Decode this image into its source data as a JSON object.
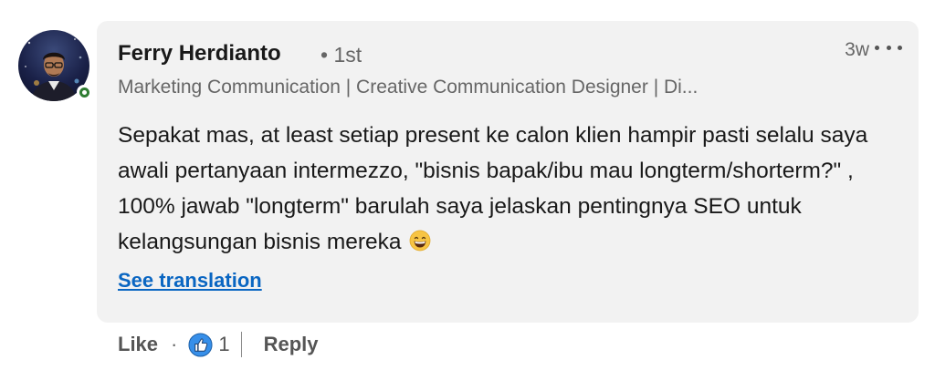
{
  "author": {
    "name": "Ferry Herdianto",
    "degree": "• 1st",
    "headline": "Marketing Communication | Creative Communication Designer | Di...",
    "status": "online",
    "status_color": "#2f7d32"
  },
  "timestamp": "3w",
  "menu_icon": "more-options-icon",
  "comment": {
    "text": "Sepakat mas, at least setiap present ke calon klien hampir pasti selalu saya awali pertanyaan intermezzo, \"bisnis bapak/ibu mau longterm/shorterm?\" , 100% jawab \"longterm\" barulah saya jelaskan pentingnya SEO untuk kelangsungan bisnis mereka",
    "emoji": "grinning-face-emoji",
    "see_translation": "See translation"
  },
  "actions": {
    "like_label": "Like",
    "separator": "·",
    "reaction_icon": "thumbs-up-reaction-icon",
    "reaction_count": "1",
    "reply_label": "Reply"
  },
  "colors": {
    "bubble_bg": "#f2f2f2",
    "link": "#0a66c2",
    "reaction_blue": "#378fe9"
  }
}
